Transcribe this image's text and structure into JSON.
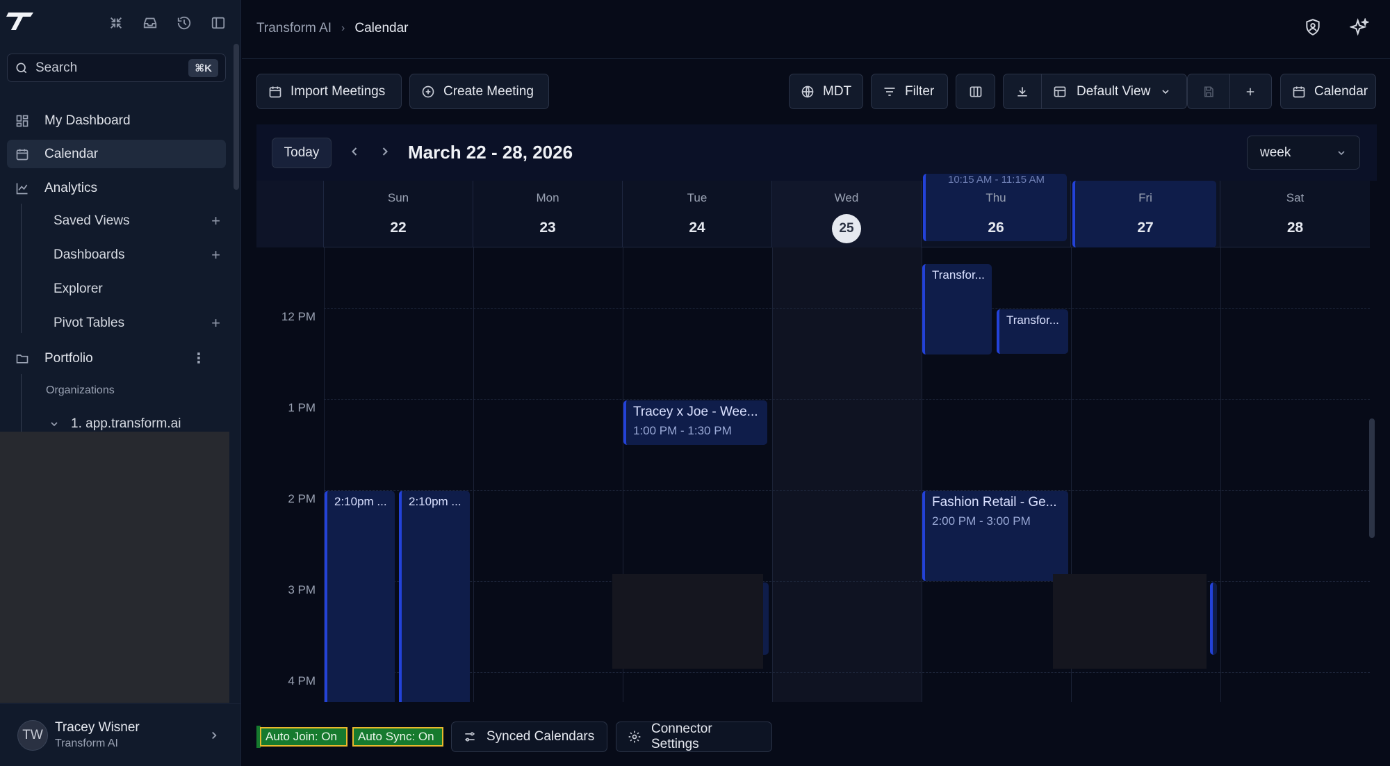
{
  "sidebar": {
    "search": {
      "placeholder": "Search",
      "shortcut": "⌘K"
    },
    "nav": {
      "dashboard": "My Dashboard",
      "calendar": "Calendar",
      "analytics": "Analytics",
      "portfolio": "Portfolio"
    },
    "analytics_items": {
      "saved_views": "Saved Views",
      "dashboards": "Dashboards",
      "explorer": "Explorer",
      "pivot_tables": "Pivot Tables"
    },
    "organizations_header": "Organizations",
    "org_item": "1. app.transform.ai",
    "user": {
      "initials": "TW",
      "name": "Tracey Wisner",
      "org": "Transform AI"
    }
  },
  "header": {
    "breadcrumb_root": "Transform AI",
    "breadcrumb_current": "Calendar"
  },
  "toolbar": {
    "import": "Import Meetings",
    "create": "Create Meeting",
    "timezone": "MDT",
    "filter": "Filter",
    "view": "Default View",
    "calendar": "Calendar"
  },
  "calendar": {
    "today": "Today",
    "range": "March 22 - 28, 2026",
    "view_mode": "week",
    "days": [
      {
        "name": "Sun",
        "date": "22"
      },
      {
        "name": "Mon",
        "date": "23"
      },
      {
        "name": "Tue",
        "date": "24"
      },
      {
        "name": "Wed",
        "date": "25"
      },
      {
        "name": "Thu",
        "date": "26"
      },
      {
        "name": "Fri",
        "date": "27"
      },
      {
        "name": "Sat",
        "date": "28"
      }
    ],
    "thu_header_event_time": "10:15 AM - 11:15 AM",
    "times": [
      "12 PM",
      "1 PM",
      "2 PM",
      "3 PM",
      "4 PM"
    ],
    "events": {
      "thu_transform_1": {
        "title": "Transfor..."
      },
      "thu_transform_2": {
        "title": "Transfor..."
      },
      "tue_tracey_joe": {
        "title": "Tracey x Joe - Wee...",
        "time": "1:00 PM - 1:30 PM"
      },
      "sun_a": {
        "title": "2:10pm ..."
      },
      "sun_b": {
        "title": "2:10pm ..."
      },
      "thu_fashion": {
        "title": "Fashion Retail - Ge...",
        "time": "2:00 PM - 3:00 PM"
      }
    }
  },
  "footer": {
    "auto_join": "Auto Join: On",
    "auto_sync": "Auto Sync: On",
    "synced": "Synced Calendars",
    "connector": "Connector Settings"
  }
}
